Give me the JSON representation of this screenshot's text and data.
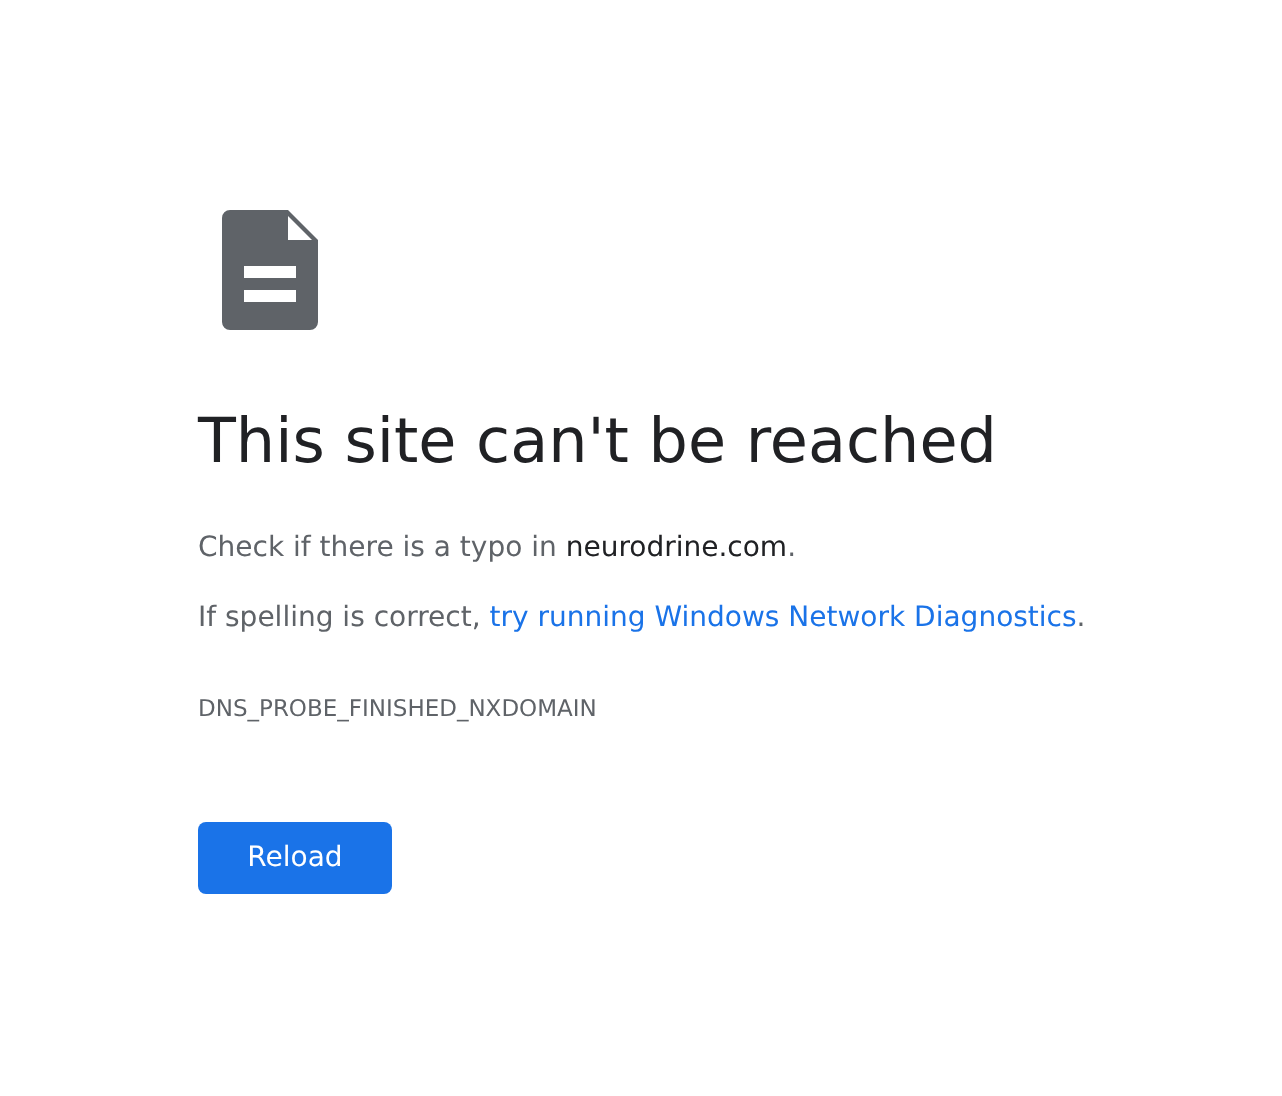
{
  "error_page": {
    "title": "This site can't be reached",
    "typo_hint": {
      "before": "Check if there is a typo in ",
      "domain": "neurodrine.com",
      "after": "."
    },
    "diagnostics_hint": {
      "before": "If spelling is correct, ",
      "link": "try running Windows Network Diagnostics",
      "after": "."
    },
    "error_code": "DNS_PROBE_FINISHED_NXDOMAIN",
    "buttons": [
      "Reload"
    ]
  }
}
